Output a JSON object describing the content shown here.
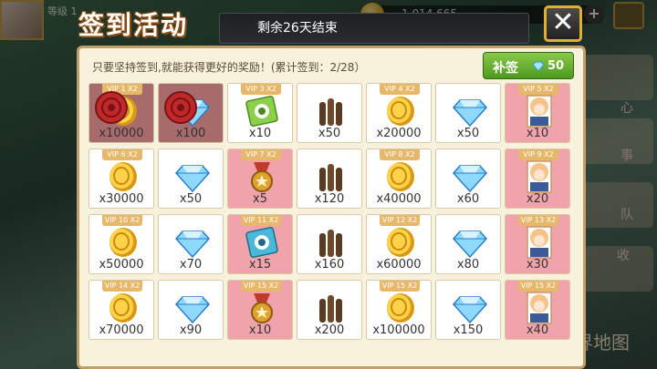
{
  "background": {
    "player_name": "等级 1",
    "gold_value": "1,014,665",
    "side_labels": [
      "心",
      "事",
      "队",
      "收"
    ],
    "world_map": "界地图"
  },
  "header": {
    "title": "签到活动",
    "remaining": "剩余26天结束",
    "close_icon": "close-icon"
  },
  "panel": {
    "hint": "只要坚持签到,就能获得更好的奖励！(累计签到：2/28）",
    "resign_label": "补签",
    "resign_cost": "50"
  },
  "colors": {
    "panel_bg": "#f8f1dc",
    "vip_cell": "#f0a3aa",
    "claimed_cell": "#a86b6b",
    "resign_green": "#6cb43a",
    "title_outline": "#8a4a12"
  },
  "rewards": [
    {
      "vip": "VIP 1 X2",
      "item": "coin",
      "qty": "x10000",
      "style": "claimed",
      "sealed": true
    },
    {
      "vip": "",
      "item": "gem",
      "qty": "x100",
      "style": "claimed",
      "sealed": true
    },
    {
      "vip": "VIP 3 X2",
      "item": "training-green",
      "qty": "x10",
      "style": "plain",
      "sealed": false
    },
    {
      "vip": "",
      "item": "ammo",
      "qty": "x50",
      "style": "plain",
      "sealed": false
    },
    {
      "vip": "VIP 4 X2",
      "item": "coin",
      "qty": "x20000",
      "style": "plain",
      "sealed": false
    },
    {
      "vip": "",
      "item": "gem",
      "qty": "x50",
      "style": "plain",
      "sealed": false
    },
    {
      "vip": "VIP 5 X2",
      "item": "girl",
      "qty": "x10",
      "style": "vip",
      "sealed": false
    },
    {
      "vip": "VIP 6 X2",
      "item": "coin",
      "qty": "x30000",
      "style": "plain",
      "sealed": false
    },
    {
      "vip": "",
      "item": "gem",
      "qty": "x50",
      "style": "plain",
      "sealed": false
    },
    {
      "vip": "VIP 7 X2",
      "item": "medal",
      "qty": "x5",
      "style": "vip",
      "sealed": false
    },
    {
      "vip": "",
      "item": "ammo",
      "qty": "x120",
      "style": "plain",
      "sealed": false
    },
    {
      "vip": "VIP 8 X2",
      "item": "coin",
      "qty": "x40000",
      "style": "plain",
      "sealed": false
    },
    {
      "vip": "",
      "item": "gem",
      "qty": "x60",
      "style": "plain",
      "sealed": false
    },
    {
      "vip": "VIP 9 X2",
      "item": "girl",
      "qty": "x20",
      "style": "vip",
      "sealed": false
    },
    {
      "vip": "VIP 10 X2",
      "item": "coin",
      "qty": "x50000",
      "style": "plain",
      "sealed": false
    },
    {
      "vip": "",
      "item": "gem",
      "qty": "x70",
      "style": "plain",
      "sealed": false
    },
    {
      "vip": "VIP 11 X2",
      "item": "training-blue",
      "qty": "x15",
      "style": "vip",
      "sealed": false
    },
    {
      "vip": "",
      "item": "ammo",
      "qty": "x160",
      "style": "plain",
      "sealed": false
    },
    {
      "vip": "VIP 12 X2",
      "item": "coin",
      "qty": "x60000",
      "style": "plain",
      "sealed": false
    },
    {
      "vip": "",
      "item": "gem",
      "qty": "x80",
      "style": "plain",
      "sealed": false
    },
    {
      "vip": "VIP 13 X2",
      "item": "girl",
      "qty": "x30",
      "style": "vip",
      "sealed": false
    },
    {
      "vip": "VIP 14 X2",
      "item": "coin",
      "qty": "x70000",
      "style": "plain",
      "sealed": false
    },
    {
      "vip": "",
      "item": "gem",
      "qty": "x90",
      "style": "plain",
      "sealed": false
    },
    {
      "vip": "VIP 15 X2",
      "item": "medal",
      "qty": "x10",
      "style": "vip",
      "sealed": false
    },
    {
      "vip": "",
      "item": "ammo",
      "qty": "x200",
      "style": "plain",
      "sealed": false
    },
    {
      "vip": "VIP 15 X2",
      "item": "coin",
      "qty": "x100000",
      "style": "plain",
      "sealed": false
    },
    {
      "vip": "",
      "item": "gem",
      "qty": "x150",
      "style": "plain",
      "sealed": false
    },
    {
      "vip": "VIP 15 X2",
      "item": "girl",
      "qty": "x40",
      "style": "vip",
      "sealed": false
    }
  ]
}
